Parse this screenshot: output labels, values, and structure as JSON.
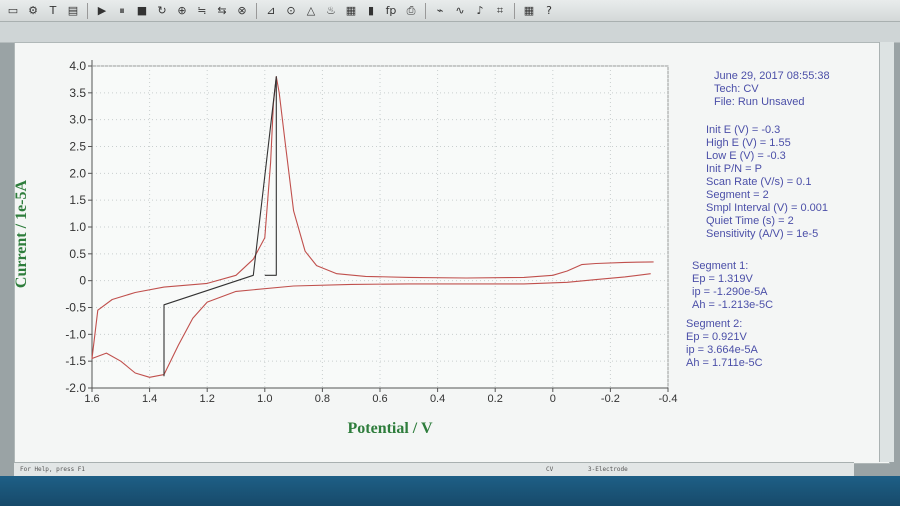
{
  "toolbar": {
    "buttons": [
      {
        "icon": "open-icon",
        "glyph": "▭"
      },
      {
        "icon": "settings-icon",
        "glyph": "⚙"
      },
      {
        "icon": "technique-icon",
        "glyph": "T"
      },
      {
        "icon": "parameters-icon",
        "glyph": "▤"
      },
      {
        "icon": "run-icon",
        "glyph": "▶"
      },
      {
        "icon": "pause-icon",
        "glyph": "⏸"
      },
      {
        "icon": "stop-icon",
        "glyph": "■"
      },
      {
        "icon": "reverse-icon",
        "glyph": "↻"
      },
      {
        "icon": "ir-comp-icon",
        "glyph": "⊕"
      },
      {
        "icon": "filter-icon",
        "glyph": "≒"
      },
      {
        "icon": "cell-icon",
        "glyph": "⇆"
      },
      {
        "icon": "control-icon",
        "glyph": "⊗"
      },
      {
        "icon": "graph-icon",
        "glyph": "⊿"
      },
      {
        "icon": "zoom-icon",
        "glyph": "⊙"
      },
      {
        "icon": "peak-icon",
        "glyph": "△"
      },
      {
        "icon": "smooth-icon",
        "glyph": "♨"
      },
      {
        "icon": "overlay-icon",
        "glyph": "▦"
      },
      {
        "icon": "bars-icon",
        "glyph": "▮"
      },
      {
        "icon": "fp-icon",
        "glyph": "fp"
      },
      {
        "icon": "print-icon",
        "glyph": "⎙"
      },
      {
        "icon": "baseline-icon",
        "glyph": "⌁"
      },
      {
        "icon": "wave-icon",
        "glyph": "∿"
      },
      {
        "icon": "analysis-icon",
        "glyph": "♪"
      },
      {
        "icon": "marker-icon",
        "glyph": "⌗"
      },
      {
        "icon": "table-icon",
        "glyph": "▦"
      },
      {
        "icon": "help-icon",
        "glyph": "?"
      }
    ]
  },
  "info": {
    "header": [
      "June 29, 2017   08:55:38",
      "Tech: CV",
      "File: Run Unsaved"
    ],
    "params": [
      "Init E (V) = -0.3",
      "High E (V) = 1.55",
      "Low E (V) = -0.3",
      "Init P/N = P",
      "Scan Rate (V/s) = 0.1",
      "Segment = 2",
      "Smpl Interval (V) = 0.001",
      "Quiet Time (s) = 2",
      "Sensitivity (A/V) = 1e-5"
    ],
    "segment1": [
      "Segment 1:",
      "Ep = 1.319V",
      "ip = -1.290e-5A",
      "Ah = -1.213e-5C"
    ],
    "segment2": [
      "Segment 2:",
      "Ep = 0.921V",
      "ip = 3.664e-5A",
      "Ah = 1.711e-5C"
    ]
  },
  "status": {
    "left": "For Help, press F1",
    "mid": "CV",
    "right": "3-Electrode"
  },
  "chart_data": {
    "type": "line",
    "xlabel": "Potential / V",
    "ylabel": "Current / 1e-5A",
    "xlim": [
      1.6,
      -0.4
    ],
    "ylim": [
      -2.0,
      4.0
    ],
    "x_reversed": true,
    "xticks": [
      "1.6",
      "1.4",
      "1.2",
      "1.0",
      "0.8",
      "0.6",
      "0.4",
      "0.2",
      "0",
      "-0.2",
      "-0.4"
    ],
    "yticks": [
      "4.0",
      "3.5",
      "3.0",
      "2.5",
      "2.0",
      "1.5",
      "1.0",
      "0.5",
      "0",
      "-0.5",
      "-1.0",
      "-1.5",
      "-2.0"
    ],
    "grid": true,
    "series": [
      {
        "color": "#c0504d",
        "points": [
          [
            -0.35,
            0.35
          ],
          [
            -0.25,
            0.34
          ],
          [
            -0.15,
            0.32
          ],
          [
            -0.1,
            0.3
          ],
          [
            -0.05,
            0.18
          ],
          [
            0.0,
            0.1
          ],
          [
            0.1,
            0.06
          ],
          [
            0.3,
            0.05
          ],
          [
            0.5,
            0.06
          ],
          [
            0.65,
            0.08
          ],
          [
            0.75,
            0.13
          ],
          [
            0.82,
            0.28
          ],
          [
            0.86,
            0.55
          ],
          [
            0.9,
            1.3
          ],
          [
            0.93,
            2.6
          ],
          [
            0.95,
            3.5
          ],
          [
            0.96,
            3.8
          ],
          [
            0.97,
            3.3
          ],
          [
            0.98,
            2.2
          ],
          [
            1.0,
            0.8
          ],
          [
            1.04,
            0.4
          ],
          [
            1.1,
            0.1
          ],
          [
            1.2,
            -0.05
          ],
          [
            1.35,
            -0.12
          ],
          [
            1.45,
            -0.22
          ],
          [
            1.53,
            -0.35
          ],
          [
            1.58,
            -0.55
          ],
          [
            1.6,
            -1.45
          ],
          [
            1.55,
            -1.35
          ],
          [
            1.5,
            -1.5
          ],
          [
            1.45,
            -1.72
          ],
          [
            1.4,
            -1.8
          ],
          [
            1.35,
            -1.75
          ],
          [
            1.3,
            -1.2
          ],
          [
            1.25,
            -0.7
          ],
          [
            1.2,
            -0.4
          ],
          [
            1.1,
            -0.2
          ],
          [
            0.9,
            -0.1
          ],
          [
            0.7,
            -0.07
          ],
          [
            0.5,
            -0.06
          ],
          [
            0.3,
            -0.06
          ],
          [
            0.1,
            -0.06
          ],
          [
            -0.05,
            -0.03
          ],
          [
            -0.15,
            0.02
          ],
          [
            -0.25,
            0.07
          ],
          [
            -0.34,
            0.13
          ]
        ]
      },
      {
        "color": "#333333",
        "points": [
          [
            1.0,
            0.1
          ],
          [
            0.96,
            0.1
          ],
          [
            0.96,
            3.8
          ],
          [
            1.04,
            0.1
          ],
          [
            1.35,
            -0.45
          ],
          [
            1.35,
            -1.78
          ]
        ]
      }
    ]
  }
}
